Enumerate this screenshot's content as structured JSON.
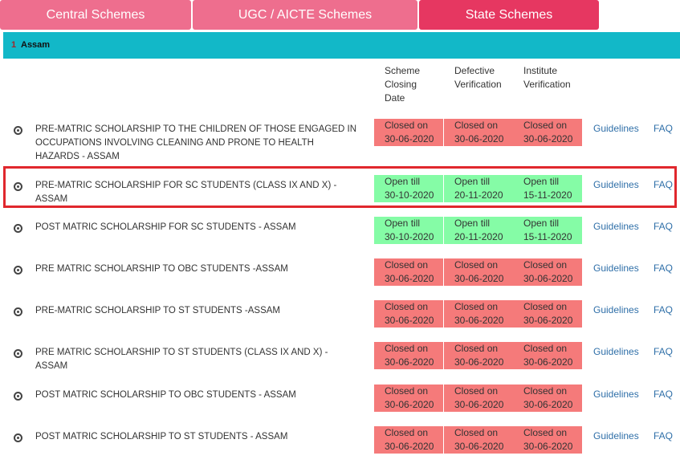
{
  "tabs": [
    {
      "label": "Central Schemes"
    },
    {
      "label": "UGC / AICTE Schemes"
    },
    {
      "label": "State Schemes"
    }
  ],
  "panel": {
    "caret": "1",
    "title": "Assam"
  },
  "columns": {
    "closing": [
      "Scheme",
      "Closing",
      "Date"
    ],
    "defective": [
      "Defective",
      "Verification"
    ],
    "institute": [
      "Institute",
      "Verification"
    ]
  },
  "links": {
    "guidelines": "Guidelines",
    "faq": "FAQ"
  },
  "schemes": [
    {
      "name": "PRE-MATRIC SCHOLARSHIP TO THE CHILDREN OF THOSE ENGAGED IN OCCUPATIONS INVOLVING CLEANING AND PRONE TO HEALTH HAZARDS - ASSAM",
      "closing": {
        "state": "Closed on",
        "date": "30-06-2020"
      },
      "defective": {
        "state": "Closed on",
        "date": "30-06-2020"
      },
      "institute": {
        "state": "Closed on",
        "date": "30-06-2020"
      }
    },
    {
      "name": "PRE-MATRIC SCHOLARSHIP FOR SC STUDENTS (CLASS IX AND X) - ASSAM",
      "closing": {
        "state": "Open till",
        "date": "30-10-2020"
      },
      "defective": {
        "state": "Open till",
        "date": "20-11-2020"
      },
      "institute": {
        "state": "Open till",
        "date": "15-11-2020"
      }
    },
    {
      "name": "POST MATRIC SCHOLARSHIP FOR SC STUDENTS - ASSAM",
      "closing": {
        "state": "Open till",
        "date": "30-10-2020"
      },
      "defective": {
        "state": "Open till",
        "date": "20-11-2020"
      },
      "institute": {
        "state": "Open till",
        "date": "15-11-2020"
      }
    },
    {
      "name": "PRE MATRIC SCHOLARSHIP TO OBC STUDENTS -ASSAM",
      "closing": {
        "state": "Closed on",
        "date": "30-06-2020"
      },
      "defective": {
        "state": "Closed on",
        "date": "30-06-2020"
      },
      "institute": {
        "state": "Closed on",
        "date": "30-06-2020"
      }
    },
    {
      "name": "PRE-MATRIC SCHOLARSHIP TO ST STUDENTS -ASSAM",
      "closing": {
        "state": "Closed on",
        "date": "30-06-2020"
      },
      "defective": {
        "state": "Closed on",
        "date": "30-06-2020"
      },
      "institute": {
        "state": "Closed on",
        "date": "30-06-2020"
      }
    },
    {
      "name": "PRE MATRIC SCHOLARSHIP TO ST STUDENTS (CLASS IX AND X) - ASSAM",
      "closing": {
        "state": "Closed on",
        "date": "30-06-2020"
      },
      "defective": {
        "state": "Closed on",
        "date": "30-06-2020"
      },
      "institute": {
        "state": "Closed on",
        "date": "30-06-2020"
      }
    },
    {
      "name": "POST MATRIC SCHOLARSHIP TO OBC STUDENTS - ASSAM",
      "closing": {
        "state": "Closed on",
        "date": "30-06-2020"
      },
      "defective": {
        "state": "Closed on",
        "date": "30-06-2020"
      },
      "institute": {
        "state": "Closed on",
        "date": "30-06-2020"
      }
    },
    {
      "name": "POST MATRIC SCHOLARSHIP TO ST STUDENTS - ASSAM",
      "closing": {
        "state": "Closed on",
        "date": "30-06-2020"
      },
      "defective": {
        "state": "Closed on",
        "date": "30-06-2020"
      },
      "institute": {
        "state": "Closed on",
        "date": "30-06-2020"
      }
    }
  ],
  "colors": {
    "tab": "#ee6e8e",
    "tab_active": "#e63761",
    "panel_header": "#12b8c8",
    "closed": "#f57a7a",
    "open": "#85fca6",
    "link": "#2f6fa8",
    "highlight": "#e0272d"
  }
}
